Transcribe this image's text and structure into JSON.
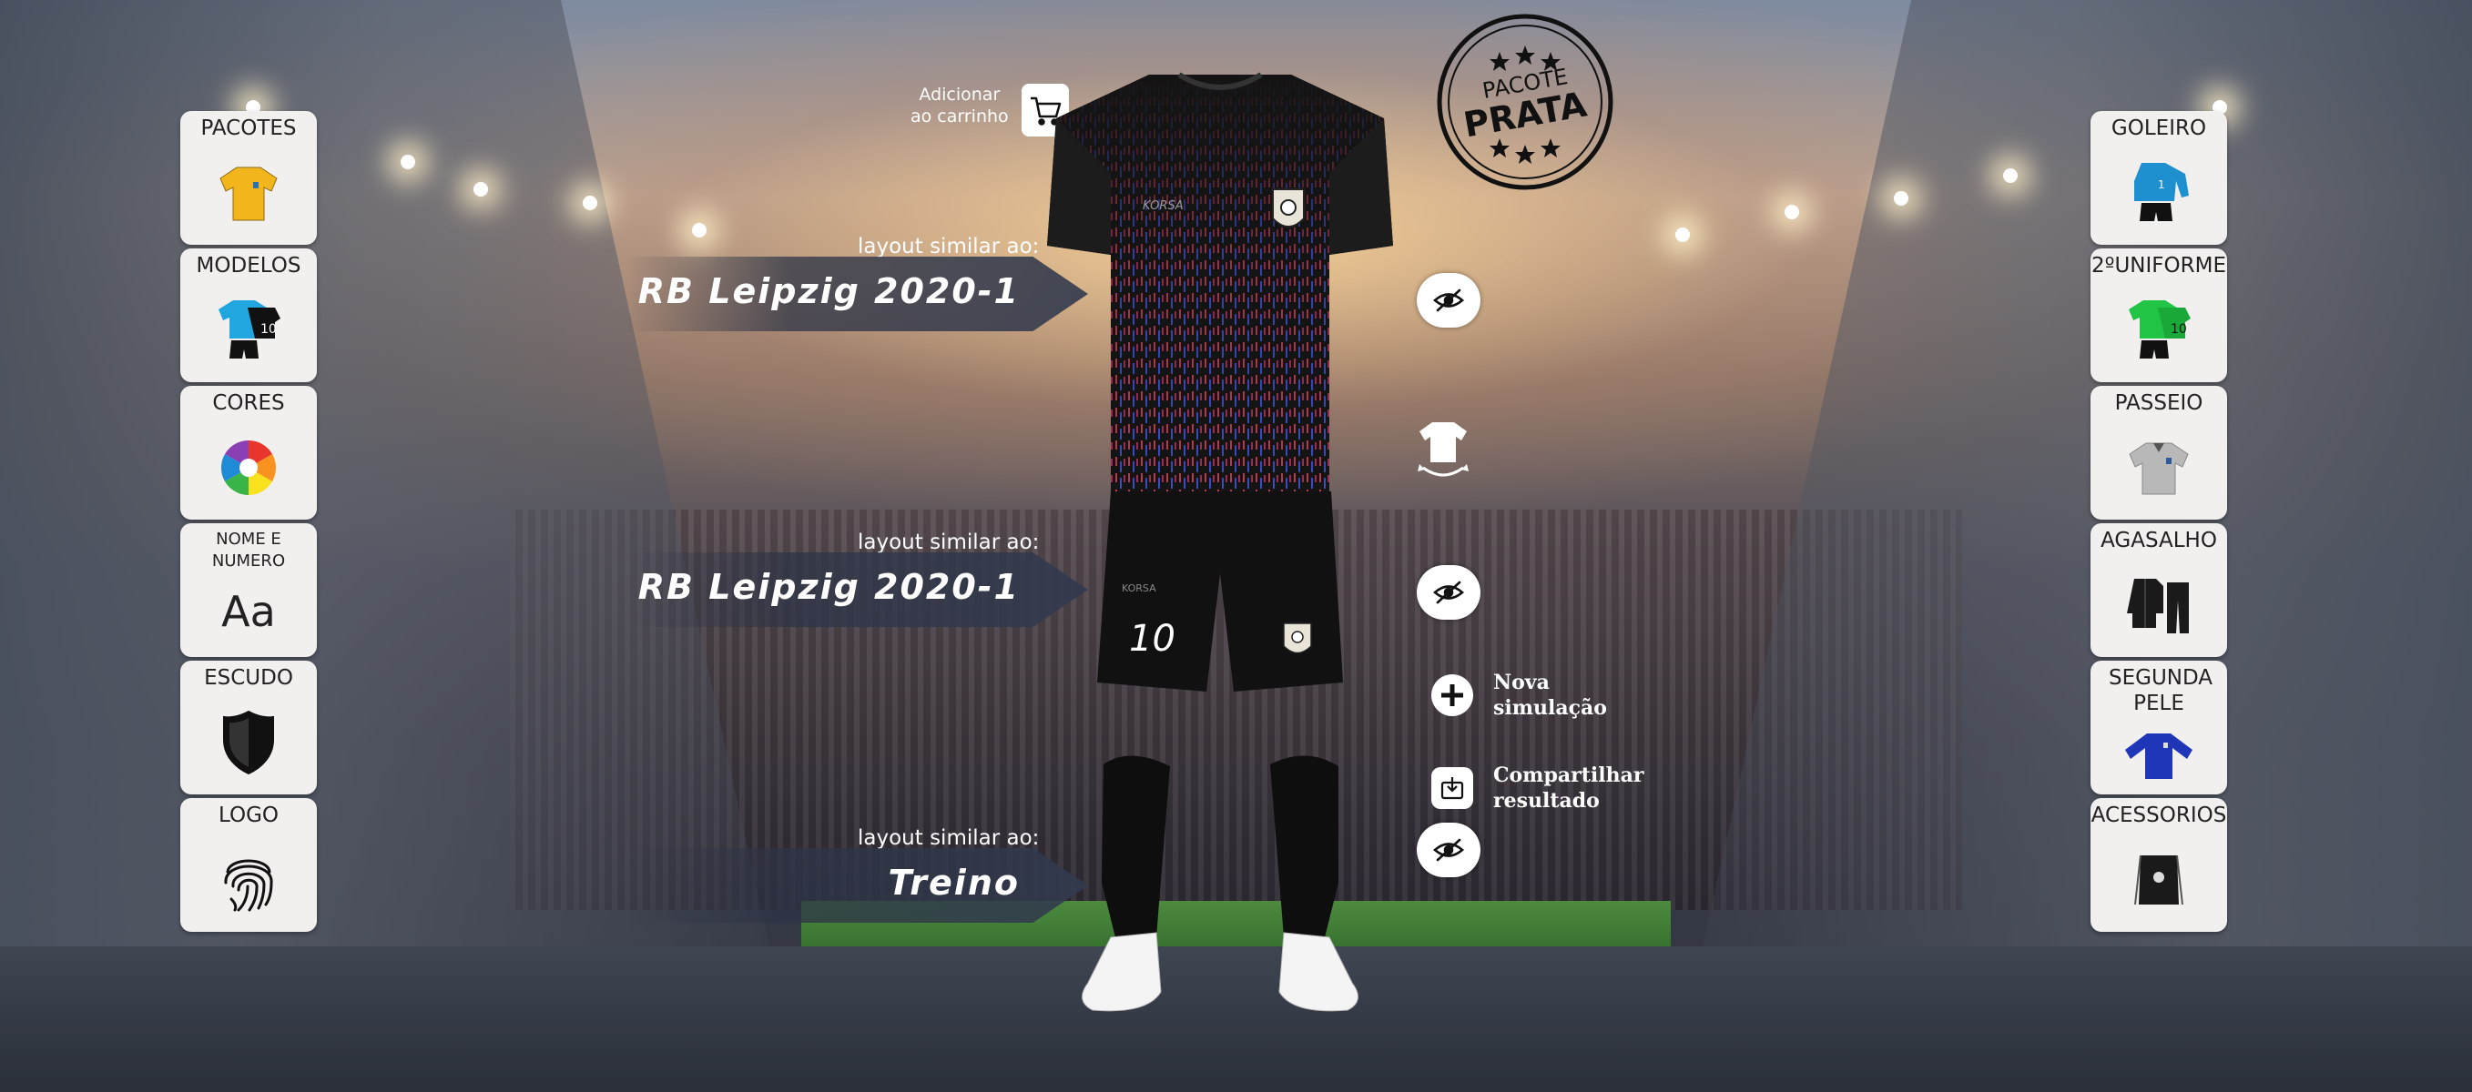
{
  "left_menu": [
    {
      "label": "PACOTES",
      "icon": "jersey-yellow-icon"
    },
    {
      "label": "MODELOS",
      "icon": "kit-blue-icon"
    },
    {
      "label": "CORES",
      "icon": "color-wheel-icon"
    },
    {
      "label": "NOME E NUMERO",
      "icon": "font-aa-icon",
      "glyph": "Aa"
    },
    {
      "label": "ESCUDO",
      "icon": "shield-icon"
    },
    {
      "label": "LOGO",
      "icon": "fingerprint-icon"
    }
  ],
  "right_menu": [
    {
      "label": "GOLEIRO",
      "icon": "goalkeeper-kit-icon"
    },
    {
      "label": "2ºUNIFORME",
      "icon": "second-kit-green-icon"
    },
    {
      "label": "PASSEIO",
      "icon": "polo-shirt-icon"
    },
    {
      "label": "AGASALHO",
      "icon": "tracksuit-icon"
    },
    {
      "label": "SEGUNDA PELE",
      "icon": "long-sleeve-shirt-icon"
    },
    {
      "label": "ACESSORIOS",
      "icon": "drawstring-bag-icon"
    }
  ],
  "cart": {
    "line1": "Adicionar",
    "line2": "ao carrinho",
    "icon": "cart-icon"
  },
  "stamp": {
    "top": "PACOTE",
    "main": "PRATA"
  },
  "layouts": [
    {
      "caption": "layout similar ao:",
      "name": "RB Leipzig 2020-1"
    },
    {
      "caption": "layout similar ao:",
      "name": "RB Leipzig 2020-1"
    },
    {
      "caption": "layout similar ao:",
      "name": "Treino"
    }
  ],
  "actions": {
    "new_sim": {
      "line1": "Nova",
      "line2": "simulação"
    },
    "share": {
      "line1": "Compartilhar",
      "line2": "resultado"
    }
  },
  "uniform": {
    "number": "10",
    "brand": "KORSA"
  },
  "colors": {
    "card_bg": "#f1f0ef",
    "jersey": "#141414",
    "pattern_red": "#c0384a",
    "pattern_blue": "#3b4cc0"
  }
}
